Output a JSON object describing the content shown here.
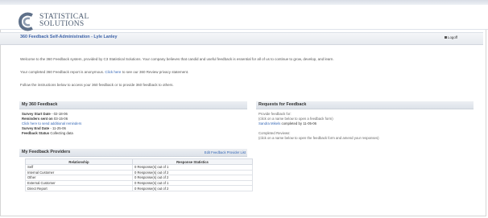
{
  "brand": {
    "line1": "STATISTICAL",
    "line2": "SOLUTIONS"
  },
  "page": {
    "title": "360 Feedback Self-Administration - Lyle Lanley",
    "logoff": "Logoff"
  },
  "intro": {
    "p1": "Welcome to the 360 Feedback system, provided by C3 Statistical Solutions.  Your company believes that candid and useful feedback is essential for all of us to continue to grow, develop, and learn.",
    "p2_before": "Your completed 360 Feedback report is anonymous.",
    "p2_link": "Click here",
    "p2_after": "to see our 360 Review privacy statement.",
    "p3": "Follow the instructions below to access your 360 feedback or to provide 360 feedback to others."
  },
  "my_feedback": {
    "heading": "My 360 Feedback",
    "start_label": "Survey Start Date",
    "start_value": "- 02-18-06",
    "reminders_label": "Reminders sent on",
    "reminders_value": "03-15-06",
    "add_link": "Click here to send additional reminders",
    "end_label": "Survey End Date",
    "end_value": "- 11-25-06",
    "status_label": "Feedback Status",
    "status_value": "Collecting data"
  },
  "providers": {
    "heading": "My Feedback Providers",
    "edit_link": "Edit Feedback Provider List",
    "columns": [
      "Relationship",
      "Response Statistics"
    ],
    "rows": [
      [
        "Self",
        "0 Response(s) out of 1"
      ],
      [
        "Internal Customer",
        "0 Response(s) out of 2"
      ],
      [
        "Other",
        "0 Response(s) out of 2"
      ],
      [
        "External Customer",
        "0 Response(s) out of 1"
      ],
      [
        "Direct Report",
        "0 Response(s) out of 2"
      ]
    ]
  },
  "requests": {
    "heading": "Requests for Feedback",
    "provide_title": "Provide feedback for:",
    "provide_hint": "(click on a name below to open a feedback form)",
    "provide_link": "Sandra Mikels",
    "provide_due": "completed by 11-05-06",
    "completed_title": "Completed Reviews:",
    "completed_hint": "(click on a name below to open the feedback form and amend your responses)"
  },
  "colors": {
    "accent": "#3d63a8",
    "link": "#3466b5"
  },
  "icons": {
    "logo": "c3-swirl-logo",
    "logoff": "lock-icon"
  }
}
